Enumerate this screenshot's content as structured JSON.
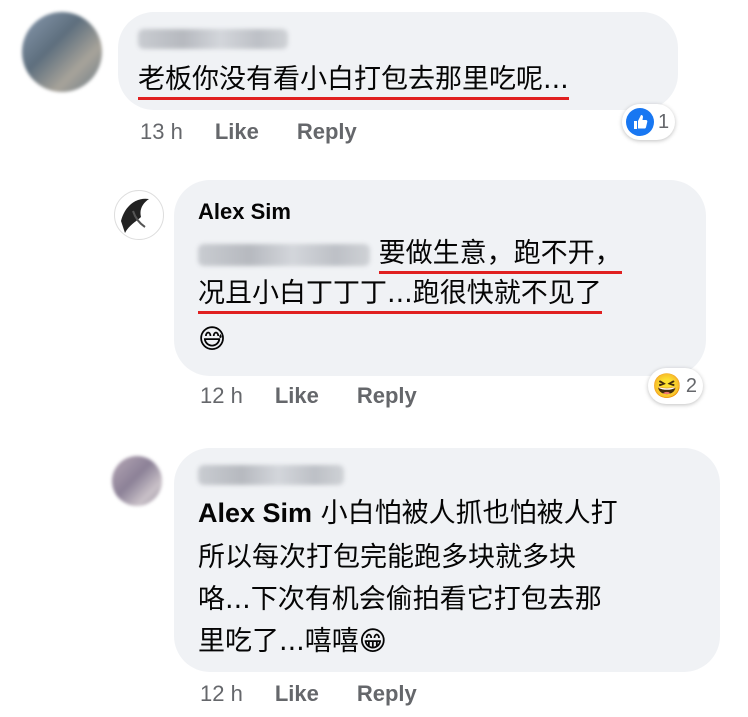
{
  "comments": [
    {
      "author_hidden": true,
      "text": "老板你没有看小白打包去那里吃呢...",
      "time": "13 h",
      "like_label": "Like",
      "reply_label": "Reply",
      "reaction": {
        "icon": "like-icon",
        "count": "1"
      }
    },
    {
      "author": "Alex Sim",
      "text_line1": "要做生意，跑不开，",
      "text_line2": "况且小白丁丁丁...跑很快就不见了",
      "emoji": "😅",
      "time": "12 h",
      "like_label": "Like",
      "reply_label": "Reply",
      "reaction": {
        "icon": "haha-icon",
        "emoji": "😆",
        "count": "2"
      }
    },
    {
      "author_hidden": true,
      "mention": "Alex Sim",
      "text_line1": " 小白怕被人抓也怕被人打",
      "text_line2": "所以每次打包完能跑多块就多块",
      "text_line3": "咯...下次有机会偷拍看它打包去那",
      "text_line4": "里吃了...嘻嘻",
      "emoji": "😁",
      "time": "12 h",
      "like_label": "Like",
      "reply_label": "Reply"
    }
  ],
  "colors": {
    "bubble": "#f0f2f5",
    "underline": "#e02020",
    "meta": "#65676b",
    "like_blue": "#1877f2"
  }
}
